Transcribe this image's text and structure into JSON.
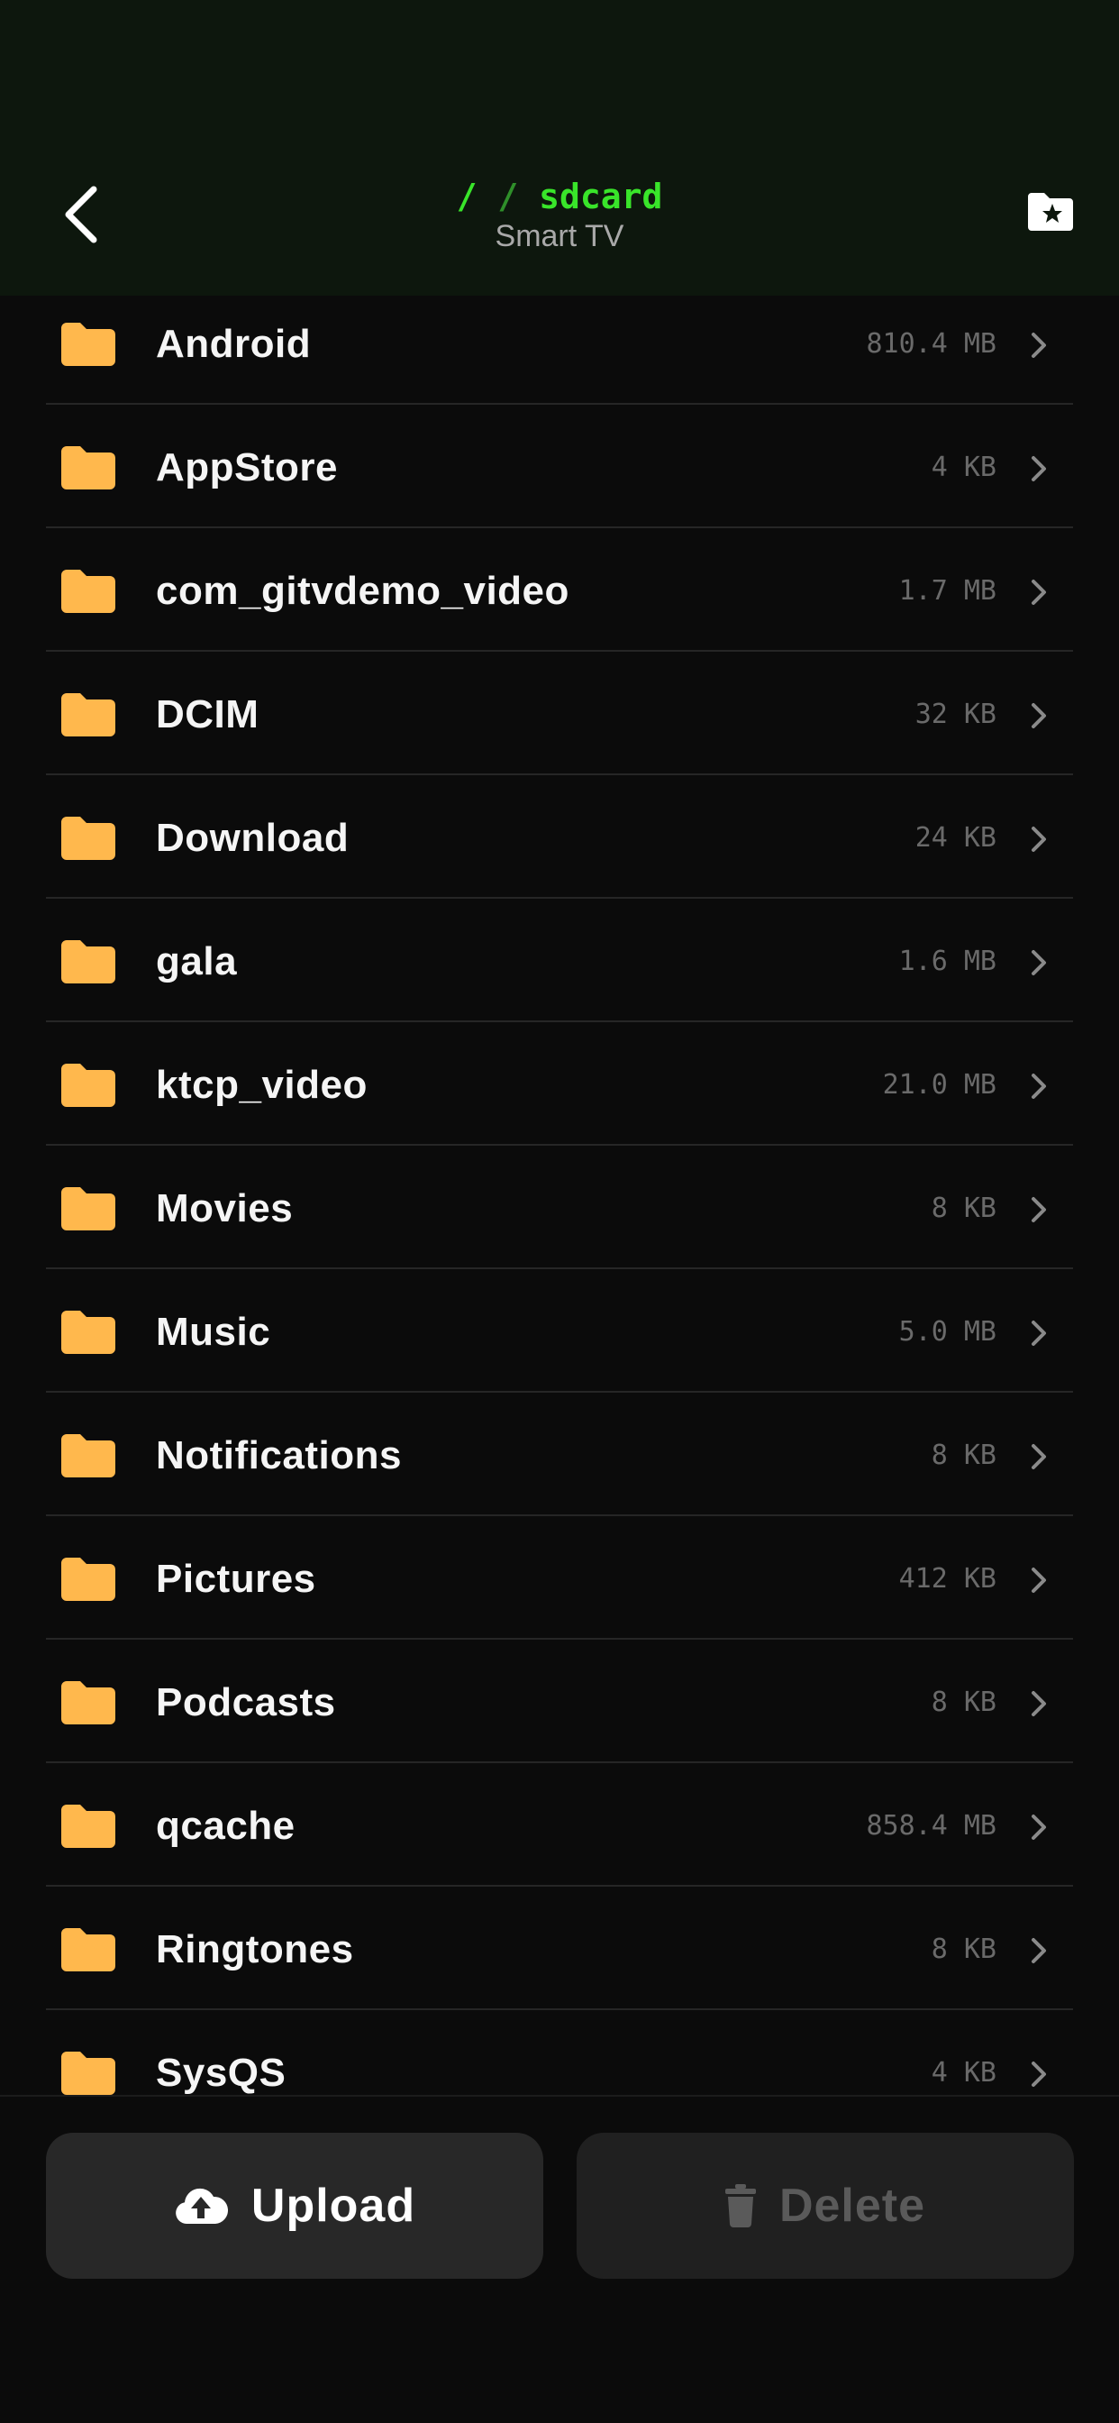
{
  "header": {
    "path_root": "/",
    "path_sep": "/",
    "path_folder": "sdcard",
    "subtitle": "Smart TV",
    "back_icon": "chevron-left-icon",
    "favorite_icon": "folder-star-icon"
  },
  "colors": {
    "header_bg": "#0d170d",
    "path_accent": "#39e52a",
    "folder": "#ffb84d",
    "background": "#0b0b0b"
  },
  "folders": [
    {
      "name": "Android",
      "size": "810.4 MB"
    },
    {
      "name": "AppStore",
      "size": "4 KB"
    },
    {
      "name": "com_gitvdemo_video",
      "size": "1.7 MB"
    },
    {
      "name": "DCIM",
      "size": "32 KB"
    },
    {
      "name": "Download",
      "size": "24 KB"
    },
    {
      "name": "gala",
      "size": "1.6 MB"
    },
    {
      "name": "ktcp_video",
      "size": "21.0 MB"
    },
    {
      "name": "Movies",
      "size": "8 KB"
    },
    {
      "name": "Music",
      "size": "5.0 MB"
    },
    {
      "name": "Notifications",
      "size": "8 KB"
    },
    {
      "name": "Pictures",
      "size": "412 KB"
    },
    {
      "name": "Podcasts",
      "size": "8 KB"
    },
    {
      "name": "qcache",
      "size": "858.4 MB"
    },
    {
      "name": "Ringtones",
      "size": "8 KB"
    },
    {
      "name": "SysQS",
      "size": "4 KB"
    }
  ],
  "actions": {
    "upload_label": "Upload",
    "delete_label": "Delete",
    "upload_icon": "cloud-upload-icon",
    "delete_icon": "trash-icon"
  }
}
